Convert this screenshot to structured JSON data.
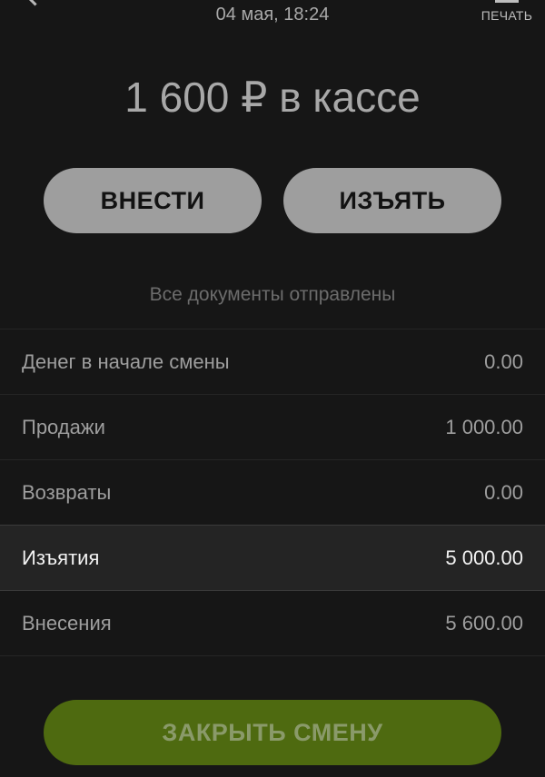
{
  "header": {
    "datetime": "04 мая, 18:24",
    "print_label": "ПЕЧАТЬ"
  },
  "cash": {
    "total_text": "1 600 ₽ в кассе"
  },
  "actions": {
    "deposit_label": "ВНЕСТИ",
    "withdraw_label": "ИЗЪЯТЬ"
  },
  "status": "Все документы отправлены",
  "summary": {
    "rows": [
      {
        "label": "Денег в начале смены",
        "value": "0.00"
      },
      {
        "label": "Продажи",
        "value": "1 000.00"
      },
      {
        "label": "Возвраты",
        "value": "0.00"
      },
      {
        "label": "Изъятия",
        "value": "5 000.00"
      },
      {
        "label": "Внесения",
        "value": "5 600.00"
      }
    ]
  },
  "footer": {
    "close_shift_label": "ЗАКРЫТЬ СМЕНУ"
  },
  "colors": {
    "background": "#161616",
    "pill_button": "#9e9e9e",
    "close_button": "#4e6a10",
    "highlight_row": "#242424"
  }
}
